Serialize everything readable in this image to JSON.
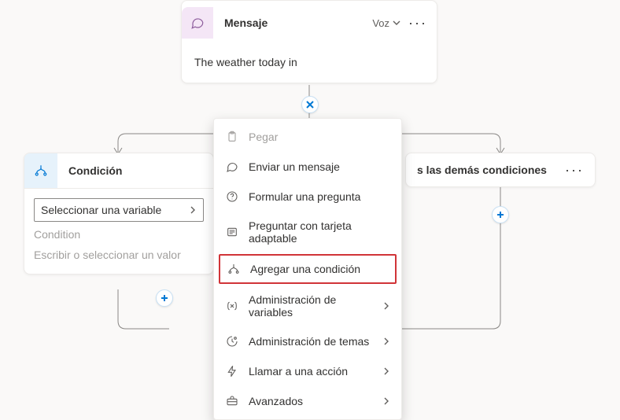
{
  "message_card": {
    "title": "Mensaje",
    "voice_label": "Voz",
    "body_text": "The weather today in"
  },
  "condition_card": {
    "title": "Condición",
    "variable_placeholder": "Seleccionar una variable",
    "condition_label": "Condition",
    "value_placeholder": "Escribir o seleccionar un valor"
  },
  "other_card": {
    "title": "s las demás condiciones"
  },
  "menu": {
    "items": {
      "paste": "Pegar",
      "send_message": "Enviar un mensaje",
      "ask_question": "Formular una pregunta",
      "adaptive_card": "Preguntar con tarjeta adaptable",
      "add_condition": "Agregar una condición",
      "var_management": "Administración de variables",
      "topic_management": "Administración de temas",
      "call_action": "Llamar a una acción",
      "advanced": "Avanzados"
    }
  }
}
